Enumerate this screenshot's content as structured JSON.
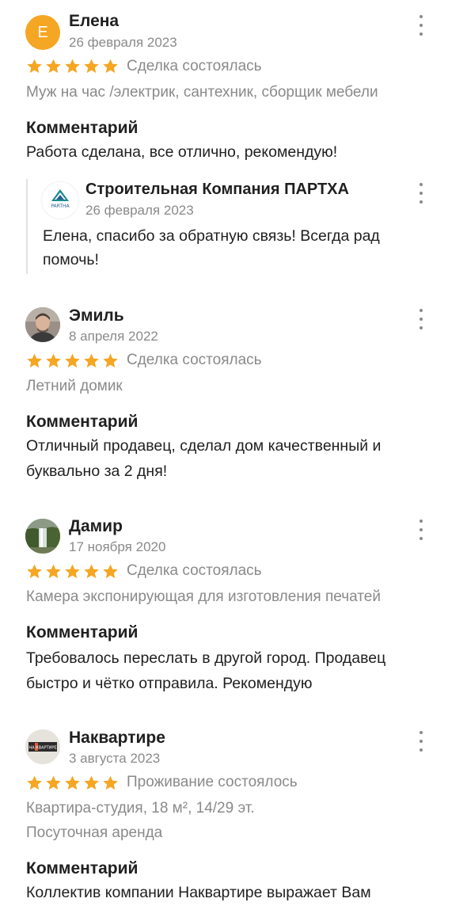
{
  "colors": {
    "star": "#f5a623",
    "muted": "#8a8a8a",
    "text": "#1f1f1f"
  },
  "reviews": [
    {
      "author": "Елена",
      "avatar_letter": "Е",
      "date": "26 февраля 2023",
      "rating": 5,
      "status": "Сделка состоялась",
      "item": "Муж на час /электрик, сантехник, сборщик мебели",
      "comment_heading": "Комментарий",
      "comment": "Работа сделана, все отлично, рекомендую!",
      "reply": {
        "company": "Строительная Компания ПАРТХА",
        "logo_text": "PARTHA",
        "date": "26 февраля 2023",
        "text": "Елена, спасибо за обратную связь! Всегда рад помочь!"
      }
    },
    {
      "author": "Эмиль",
      "avatar_icon": "person-photo-icon",
      "date": "8 апреля 2022",
      "rating": 5,
      "status": "Сделка состоялась",
      "item": "Летний домик",
      "comment_heading": "Комментарий",
      "comment": "Отличный продавец, сделал дом качественный и буквально за 2 дня!"
    },
    {
      "author": "Дамир",
      "avatar_icon": "waterfall-photo-icon",
      "date": "17 ноября 2020",
      "rating": 5,
      "status": "Сделка состоялась",
      "item": "Камера экспонирующая для изготовления печатей",
      "comment_heading": "Комментарий",
      "comment": "Требовалось переслать в другой город. Продавец быстро и чётко отправила. Рекомендую"
    },
    {
      "author": "Наквартире",
      "avatar_icon": "nakvartire-logo-icon",
      "avatar_text": "НА КВАРТИРЕ",
      "date": "3 августа 2023",
      "rating": 5,
      "status": "Проживание состоялось",
      "item": "Квартира-студия, 18 м², 14/29 эт.",
      "item2": "Посуточная аренда",
      "comment_heading": "Комментарий",
      "comment": "Коллектив компании Наквартире выражает Вам"
    }
  ]
}
